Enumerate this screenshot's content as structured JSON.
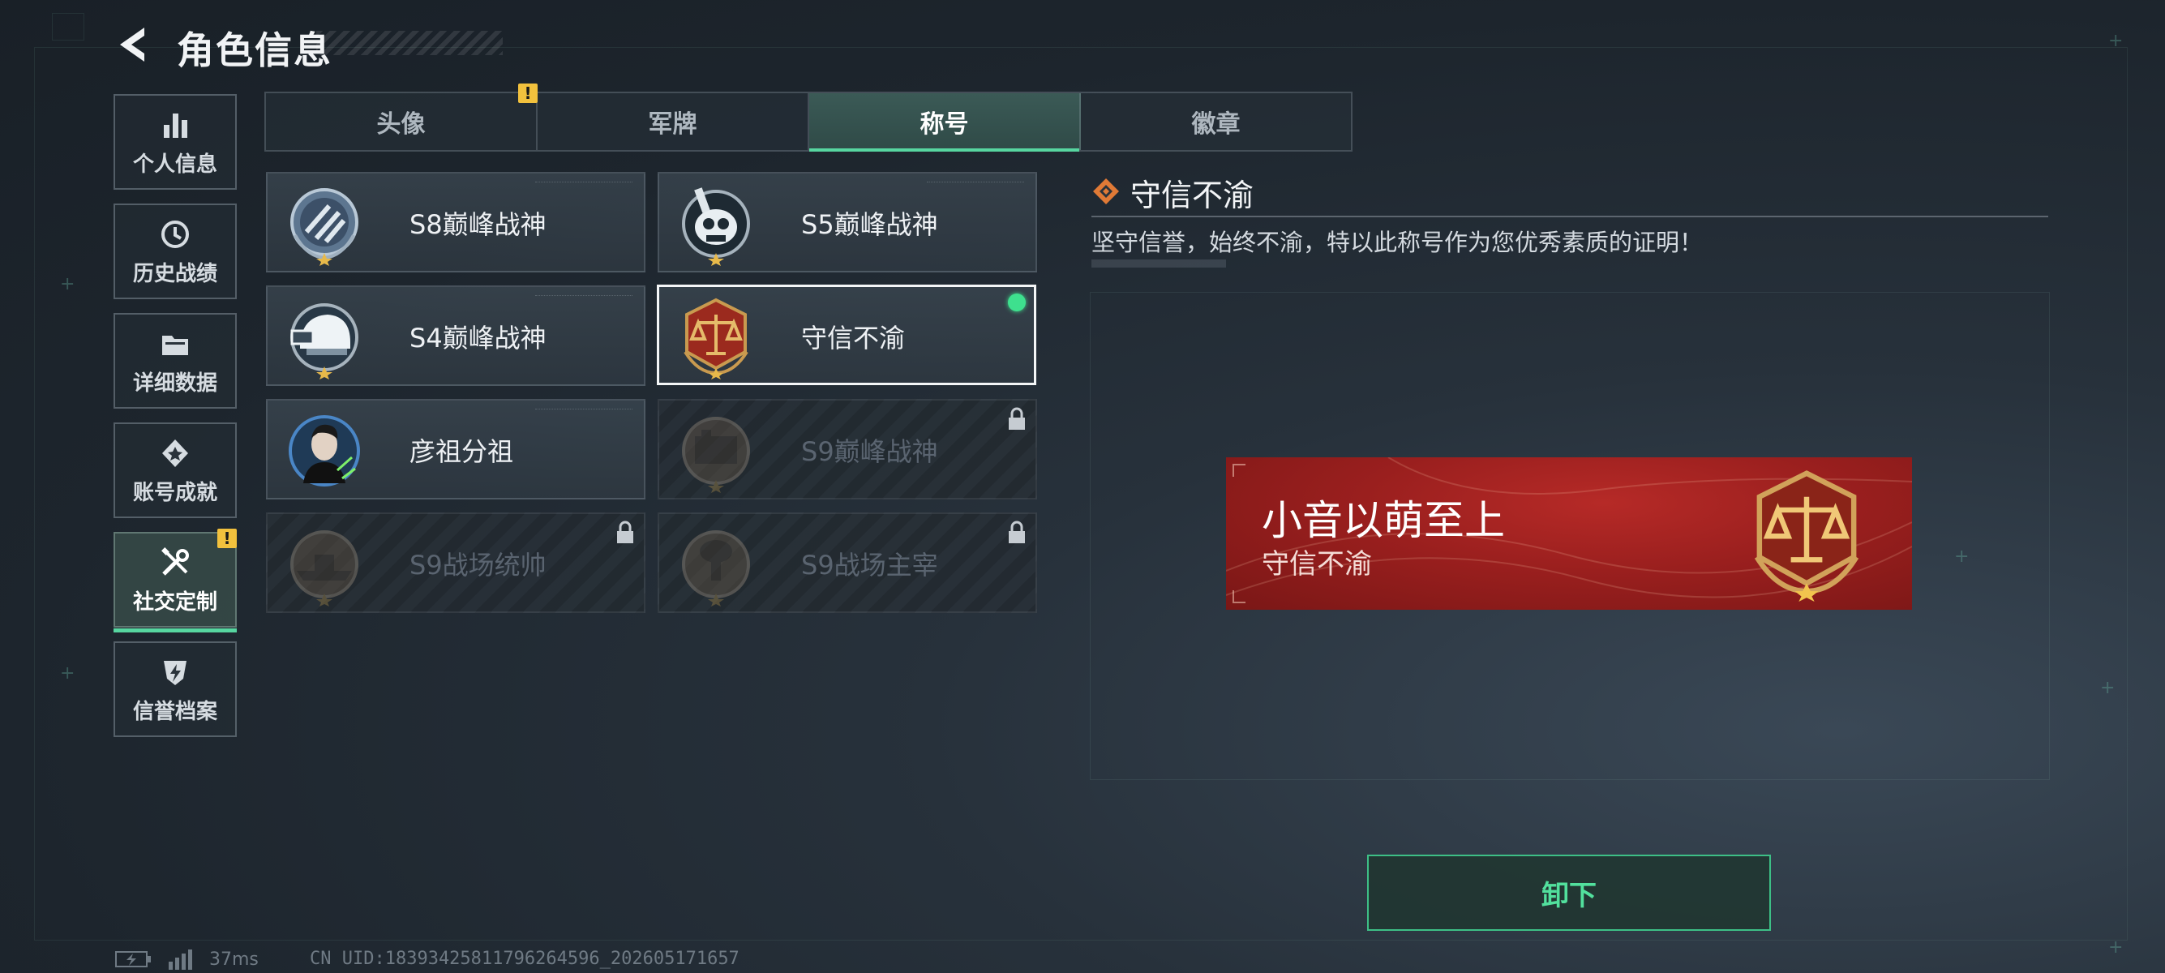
{
  "header": {
    "title": "角色信息"
  },
  "sidebar": {
    "items": [
      {
        "label": "个人信息",
        "icon": "bar-chart-icon"
      },
      {
        "label": "历史战绩",
        "icon": "history-icon"
      },
      {
        "label": "详细数据",
        "icon": "folder-icon"
      },
      {
        "label": "账号成就",
        "icon": "achievement-icon"
      },
      {
        "label": "社交定制",
        "icon": "tools-icon",
        "active": true,
        "alert": "!"
      },
      {
        "label": "信誉档案",
        "icon": "shield-bolt-icon"
      }
    ]
  },
  "tabs": {
    "items": [
      {
        "label": "头像",
        "alert": "!"
      },
      {
        "label": "军牌"
      },
      {
        "label": "称号",
        "active": true
      },
      {
        "label": "徽章"
      }
    ]
  },
  "titles": {
    "items": [
      {
        "name": "S8巅峰战神",
        "locked": false
      },
      {
        "name": "S5巅峰战神",
        "locked": false
      },
      {
        "name": "S4巅峰战神",
        "locked": false
      },
      {
        "name": "守信不渝",
        "locked": false,
        "selected": true,
        "equipped": true
      },
      {
        "name": "彦祖分祖",
        "locked": false
      },
      {
        "name": "S9巅峰战神",
        "locked": true
      },
      {
        "name": "S9战场统帅",
        "locked": true
      },
      {
        "name": "S9战场主宰",
        "locked": true
      }
    ]
  },
  "detail": {
    "title": "守信不渝",
    "description": "坚守信誉，始终不渝，特以此称号作为您优秀素质的证明！"
  },
  "preview": {
    "player_name": "小音以萌至上",
    "title": "守信不渝"
  },
  "actions": {
    "unequip_label": "卸下"
  },
  "status": {
    "ping": "37ms",
    "uid": "CN UID:18393425811796264596_202605171657"
  },
  "colors": {
    "accent": "#57d6a0",
    "alert": "#f2c13d",
    "plate_red": "#9a1f1e",
    "equipped_dot": "#3ee08e"
  }
}
